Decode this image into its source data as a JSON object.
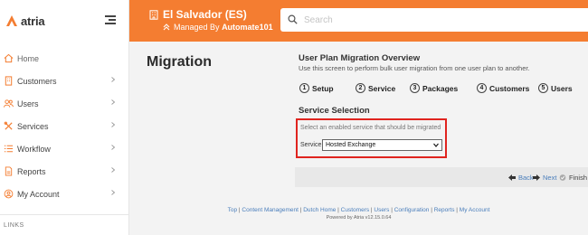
{
  "brand": {
    "name": "atria"
  },
  "sidebar": {
    "items": [
      {
        "label": "Home",
        "icon": "home-icon",
        "chevron": false
      },
      {
        "label": "Customers",
        "icon": "building-icon",
        "chevron": true
      },
      {
        "label": "Users",
        "icon": "users-icon",
        "chevron": true
      },
      {
        "label": "Services",
        "icon": "tools-icon",
        "chevron": true
      },
      {
        "label": "Workflow",
        "icon": "list-icon",
        "chevron": true
      },
      {
        "label": "Reports",
        "icon": "report-icon",
        "chevron": true
      },
      {
        "label": "My Account",
        "icon": "account-icon",
        "chevron": true
      }
    ],
    "links_heading": "LINKS"
  },
  "header": {
    "tenant_name": "El Salvador (ES)",
    "managed_prefix": "Managed By",
    "managed_by": "Automate101",
    "search_placeholder": "Search"
  },
  "page": {
    "title": "Migration"
  },
  "wizard": {
    "title": "User Plan Migration Overview",
    "subtitle": "Use this screen to perform bulk user migration from one user plan to another.",
    "steps": [
      {
        "num": "1",
        "label": "Setup"
      },
      {
        "num": "2",
        "label": "Service"
      },
      {
        "num": "3",
        "label": "Packages"
      },
      {
        "num": "4",
        "label": "Customers"
      },
      {
        "num": "5",
        "label": "Users"
      }
    ],
    "section_title": "Service Selection",
    "hint": "Select an enabled service that should be migrated",
    "service_label": "Service:",
    "service_value": "Hosted Exchange",
    "back_label": "Back",
    "next_label": "Next",
    "finish_label": "Finish"
  },
  "footer": {
    "links": [
      "Top",
      "Content Management",
      "Dutch Home",
      "Customers",
      "Users",
      "Configuration",
      "Reports",
      "My Account"
    ],
    "powered_by": "Powered by Atria v12.15.0.64"
  },
  "colors": {
    "accent": "#f47d31",
    "highlight_border": "#e0241f",
    "link": "#4a7ebb"
  }
}
